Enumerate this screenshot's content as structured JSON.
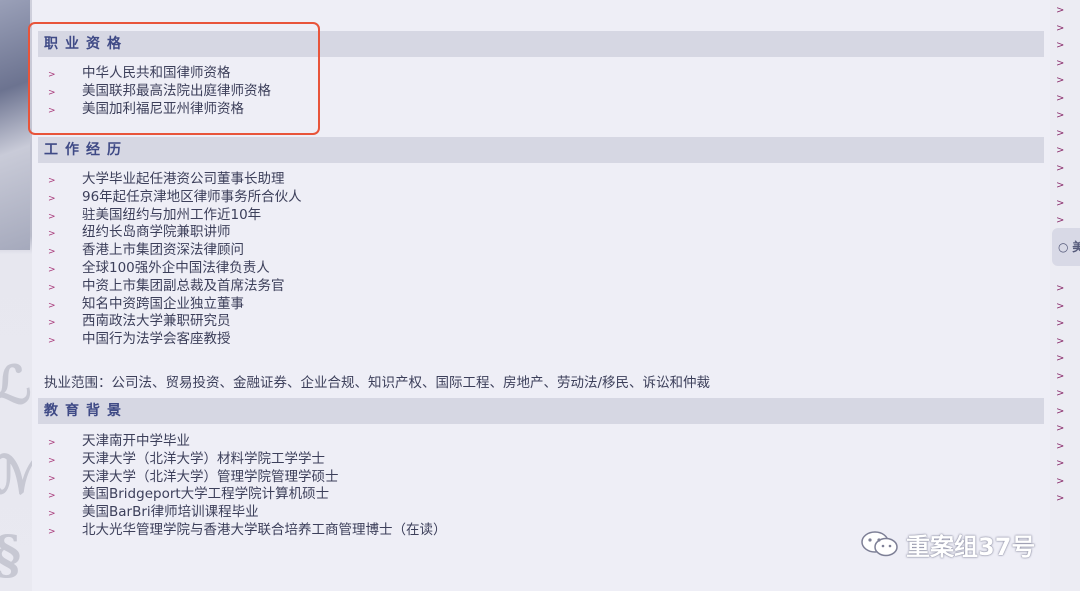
{
  "sections": [
    {
      "title": "职业资格",
      "items": [
        "中华人民共和国律师资格",
        "美国联邦最高法院出庭律师资格",
        "美国加利福尼亚州律师资格"
      ]
    },
    {
      "title": "工作经历",
      "items": [
        "大学毕业起任港资公司董事长助理",
        "96年起任京津地区律师事务所合伙人",
        "驻美国纽约与加州工作近10年",
        "纽约长岛商学院兼职讲师",
        "香港上市集团资深法律顾问",
        "全球100强外企中国法律负责人",
        "中资上市集团副总裁及首席法务官",
        "知名中资跨国企业独立董事",
        "西南政法大学兼职研究员",
        "中国行为法学会客座教授"
      ]
    },
    {
      "title": "教育背景",
      "items": [
        "天津南开中学毕业",
        "天津大学（北洋大学）材料学院工学学士",
        "天津大学（北洋大学）管理学院管理学硕士",
        "美国Bridgeport大学工程学院计算机硕士",
        "美国BarBri律师培训课程毕业",
        "北大光华管理学院与香港大学联合培养工商管理博士（在读）"
      ]
    }
  ],
  "practice_scope": "执业范围：公司法、贸易投资、金融证券、企业合规、知识产权、国际工程、房地产、劳动法/移民、诉讼和仲裁",
  "watermark": "重案组37号",
  "right_tab_label": "美",
  "colors": {
    "background": "#eeeef6",
    "section_bar": "#d6d7e3",
    "section_title": "#3f4a86",
    "arrow": "#a83a7a",
    "highlight_border": "#e8543a"
  }
}
